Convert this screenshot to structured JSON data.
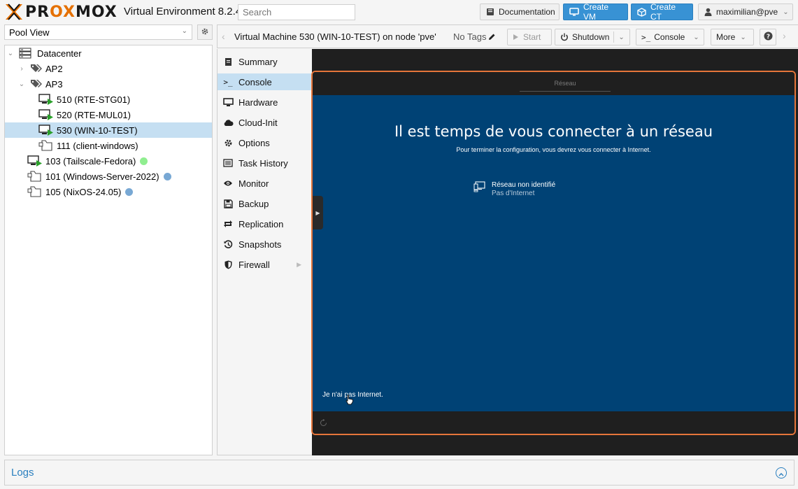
{
  "header": {
    "brand": "PROXMOX",
    "version": "Virtual Environment 8.2.4",
    "search_placeholder": "Search",
    "documentation": "Documentation",
    "create_vm": "Create VM",
    "create_ct": "Create CT",
    "user": "maximilian@pve"
  },
  "left": {
    "pool_view": "Pool View",
    "tree": [
      {
        "label": "Datacenter",
        "icon": "datacenter-icon",
        "expander": "open"
      },
      {
        "label": "AP2",
        "icon": "tags-icon",
        "expander": "closed"
      },
      {
        "label": "AP3",
        "icon": "tags-icon",
        "expander": "open"
      },
      {
        "label": "510 (RTE-STG01)",
        "icon": "vm-running-icon"
      },
      {
        "label": "520 (RTE-MUL01)",
        "icon": "vm-running-icon"
      },
      {
        "label": "530 (WIN-10-TEST)",
        "icon": "vm-running-icon",
        "selected": true
      },
      {
        "label": "111 (client-windows)",
        "icon": "vm-template-icon"
      },
      {
        "label": "103 (Tailscale-Fedora)",
        "icon": "vm-running-icon",
        "status_color": "#90ee90"
      },
      {
        "label": "101 (Windows-Server-2022)",
        "icon": "vm-template-icon",
        "status_color": "#78a8d4"
      },
      {
        "label": "105 (NixOS-24.05)",
        "icon": "vm-template-icon",
        "status_color": "#78a8d4"
      }
    ]
  },
  "main": {
    "title": "Virtual Machine 530 (WIN-10-TEST) on node 'pve'",
    "tags": "No Tags",
    "start": "Start",
    "shutdown": "Shutdown",
    "console": "Console",
    "more": "More"
  },
  "subnav": [
    {
      "label": "Summary",
      "icon": "summary-icon"
    },
    {
      "label": "Console",
      "icon": "console-icon",
      "selected": true
    },
    {
      "label": "Hardware",
      "icon": "hardware-icon"
    },
    {
      "label": "Cloud-Init",
      "icon": "cloud-icon"
    },
    {
      "label": "Options",
      "icon": "options-gear-icon"
    },
    {
      "label": "Task History",
      "icon": "task-history-icon"
    },
    {
      "label": "Monitor",
      "icon": "monitor-eye-icon"
    },
    {
      "label": "Backup",
      "icon": "backup-floppy-icon"
    },
    {
      "label": "Replication",
      "icon": "replication-icon"
    },
    {
      "label": "Snapshots",
      "icon": "snapshots-icon"
    },
    {
      "label": "Firewall",
      "icon": "firewall-shield-icon",
      "has_submenu": true
    }
  ],
  "vm_screen": {
    "tab": "Réseau",
    "heading": "Il est temps de vous connecter à un réseau",
    "subtext": "Pour terminer la configuration, vous devrez vous connecter à Internet.",
    "network_name": "Réseau non identifié",
    "network_status": "Pas d'Internet",
    "no_internet_link": "Je n'ai pas Internet."
  },
  "logs": {
    "title": "Logs"
  },
  "colors": {
    "accent": "#3892d4",
    "selection": "#c5dff2",
    "highlight_border": "#e5753a",
    "windows_blue": "#004275",
    "logo_orange": "#e57000"
  }
}
